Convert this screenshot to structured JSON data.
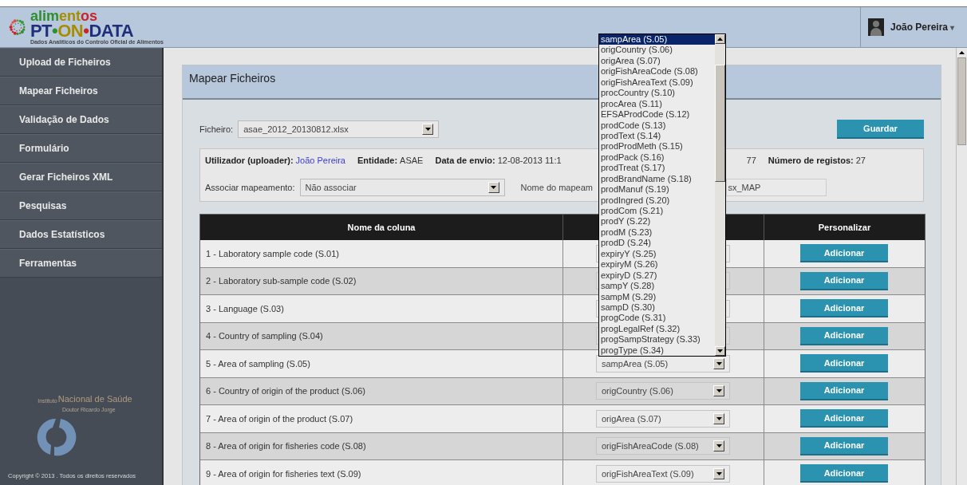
{
  "logo": {
    "title_parts": [
      {
        "text": "alim",
        "color": "#2f8f2f"
      },
      {
        "text": "ent",
        "color": "#a88c00"
      },
      {
        "text": "os",
        "color": "#c8242a"
      }
    ],
    "brand_parts": [
      {
        "text": "PT",
        "color": "#1f2f7a"
      },
      {
        "text": "•",
        "color": "#2f8f2f"
      },
      {
        "text": "ON",
        "color": "#a88c00"
      },
      {
        "text": "•",
        "color": "#c8242a"
      },
      {
        "text": "DATA",
        "color": "#1f2f7a"
      }
    ],
    "tagline": "Dados Analíticos do Controlo Oficial de Alimentos"
  },
  "user": {
    "name": "João Pereira",
    "caret": "▾"
  },
  "sidebar": {
    "items": [
      {
        "label": "Upload de Ficheiros"
      },
      {
        "label": "Mapear Ficheiros"
      },
      {
        "label": "Validação de Dados"
      },
      {
        "label": "Formulário"
      },
      {
        "label": "Gerar Ficheiros XML"
      },
      {
        "label": "Pesquisas"
      },
      {
        "label": "Dados Estatísticos"
      },
      {
        "label": "Ferramentas"
      }
    ],
    "footer": {
      "institute_small": "Instituto",
      "institute": "Nacional de Saúde",
      "institute_sub": "Doutor Ricardo Jorge",
      "copyright": "Copyright © 2013 . Todos os direitos reservados"
    }
  },
  "panel": {
    "title": "Mapear Ficheiros",
    "file": {
      "label": "Ficheiro:",
      "value": "asae_2012_20130812.xlsx"
    },
    "save_button": "Guardar",
    "info": {
      "uploader_label": "Utilizador (uploader):",
      "uploader": "João Pereira",
      "entity_label": "Entidade:",
      "entity": "ASAE",
      "date_label": "Data de envio:",
      "date_visible": "12-08-2013 11:1",
      "hidden_tail": "77",
      "records_label": "Número de registos:",
      "records": "27"
    },
    "association": {
      "label": "Associar mapeamento:",
      "value": "Não associar",
      "name_label_visible": "Nome do mapeam",
      "name_value_visible": "sx_MAP"
    },
    "table": {
      "columns": [
        "Nome da coluna",
        "Personalizar"
      ],
      "rows": [
        {
          "name": "1 - Laboratory sample code (S.01)",
          "button": "Adicionar"
        },
        {
          "name": "2 - Laboratory sub-sample code (S.02)",
          "button": "Adicionar"
        },
        {
          "name": "3 - Language (S.03)",
          "button": "Adicionar"
        },
        {
          "name": "4 - Country of sampling (S.04)",
          "button": "Adicionar"
        },
        {
          "name": "5 - Area of sampling (S.05)",
          "mapping": "sampArea (S.05)",
          "button": "Adicionar"
        },
        {
          "name": "6 - Country of origin of the product (S.06)",
          "mapping": "origCountry (S.06)",
          "button": "Adicionar"
        },
        {
          "name": "7 - Area of origin of the product (S.07)",
          "mapping": "origArea (S.07)",
          "button": "Adicionar"
        },
        {
          "name": "8 - Area of origin for fisheries code (S.08)",
          "mapping": "origFishAreaCode (S.08)",
          "button": "Adicionar"
        },
        {
          "name": "9 - Area of origin for fisheries text (S.09)",
          "mapping": "origFishAreaText (S.09)",
          "button": "Adicionar"
        }
      ]
    }
  },
  "dropdown_list": {
    "options": [
      {
        "label": "sampArea (S.05)",
        "selected": true
      },
      {
        "label": "origCountry (S.06)",
        "selected": false
      },
      {
        "label": "origArea (S.07)",
        "selected": false
      },
      {
        "label": "origFishAreaCode (S.08)",
        "selected": false
      },
      {
        "label": "origFishAreaText (S.09)",
        "selected": false
      },
      {
        "label": "procCountry (S.10)",
        "selected": false
      },
      {
        "label": "procArea (S.11)",
        "selected": false
      },
      {
        "label": "EFSAProdCode (S.12)",
        "selected": false
      },
      {
        "label": "prodCode (S.13)",
        "selected": false
      },
      {
        "label": "prodText (S.14)",
        "selected": false
      },
      {
        "label": "prodProdMeth (S.15)",
        "selected": false
      },
      {
        "label": "prodPack (S.16)",
        "selected": false
      },
      {
        "label": "prodTreat (S.17)",
        "selected": false
      },
      {
        "label": "prodBrandName (S.18)",
        "selected": false
      },
      {
        "label": "prodManuf (S.19)",
        "selected": false
      },
      {
        "label": "prodIngred (S.20)",
        "selected": false
      },
      {
        "label": "prodCom (S.21)",
        "selected": false
      },
      {
        "label": "prodY (S.22)",
        "selected": false
      },
      {
        "label": "prodM (S.23)",
        "selected": false
      },
      {
        "label": "prodD (S.24)",
        "selected": false
      },
      {
        "label": "expiryY (S.25)",
        "selected": false
      },
      {
        "label": "expiryM (S.26)",
        "selected": false
      },
      {
        "label": "expiryD (S.27)",
        "selected": false
      },
      {
        "label": "sampY (S.28)",
        "selected": false
      },
      {
        "label": "sampM (S.29)",
        "selected": false
      },
      {
        "label": "sampD (S.30)",
        "selected": false
      },
      {
        "label": "progCode (S.31)",
        "selected": false
      },
      {
        "label": "progLegalRef (S.32)",
        "selected": false
      },
      {
        "label": "progSampStrategy (S.33)",
        "selected": false
      },
      {
        "label": "progType (S.34)",
        "selected": false
      }
    ]
  }
}
